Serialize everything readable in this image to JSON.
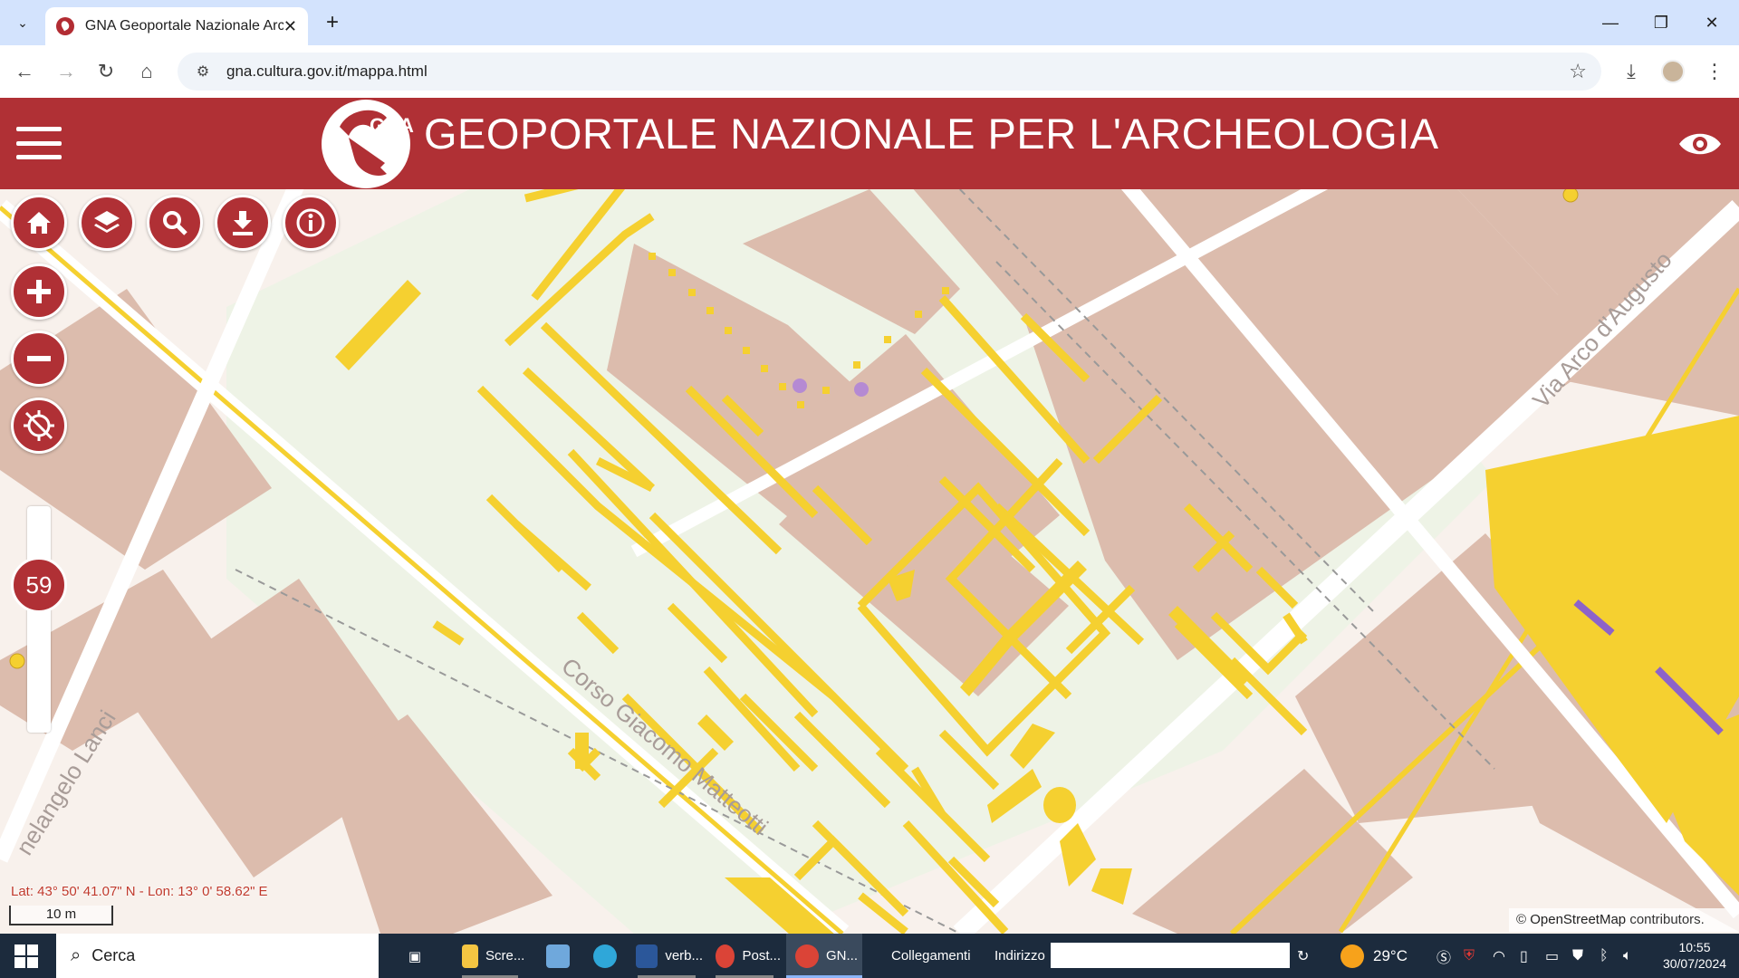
{
  "browser": {
    "tab_title": "GNA Geoportale Nazionale Arc",
    "url": "gna.cultura.gov.it/mappa.html"
  },
  "site": {
    "logo_text": "GNA",
    "title": "GEOPORTALE NAZIONALE PER L'ARCHEOLOGIA"
  },
  "map": {
    "zoom_level": "59",
    "coordinates": "Lat: 43° 50' 41.07\" N - Lon: 13° 0' 58.62\" E",
    "scale_label": "10 m",
    "attribution_prefix": "©",
    "attribution_link": "OpenStreetMap",
    "attribution_suffix": "contributors.",
    "streets": {
      "arco": "Via Arco d'Augusto",
      "matteotti": "Corso Giacomo Matteotti",
      "lanci": "nelangelo Lanci"
    },
    "colors": {
      "accent": "#b03035",
      "feature": "#f5d030",
      "building": "#dcbcad",
      "park": "#eef3e6"
    }
  },
  "taskbar": {
    "search_placeholder": "Cerca",
    "items": [
      {
        "label": "Scre...",
        "icon": "folder-icon"
      },
      {
        "label": "",
        "icon": "control-panel-icon"
      },
      {
        "label": "",
        "icon": "edge-icon"
      },
      {
        "label": "verb...",
        "icon": "word-icon"
      },
      {
        "label": "Post...",
        "icon": "chrome-icon"
      },
      {
        "label": "GN...",
        "icon": "chrome-icon"
      }
    ],
    "links_label": "Collegamenti",
    "address_label": "Indirizzo",
    "temperature": "29°C",
    "time": "10:55",
    "date": "30/07/2024"
  }
}
